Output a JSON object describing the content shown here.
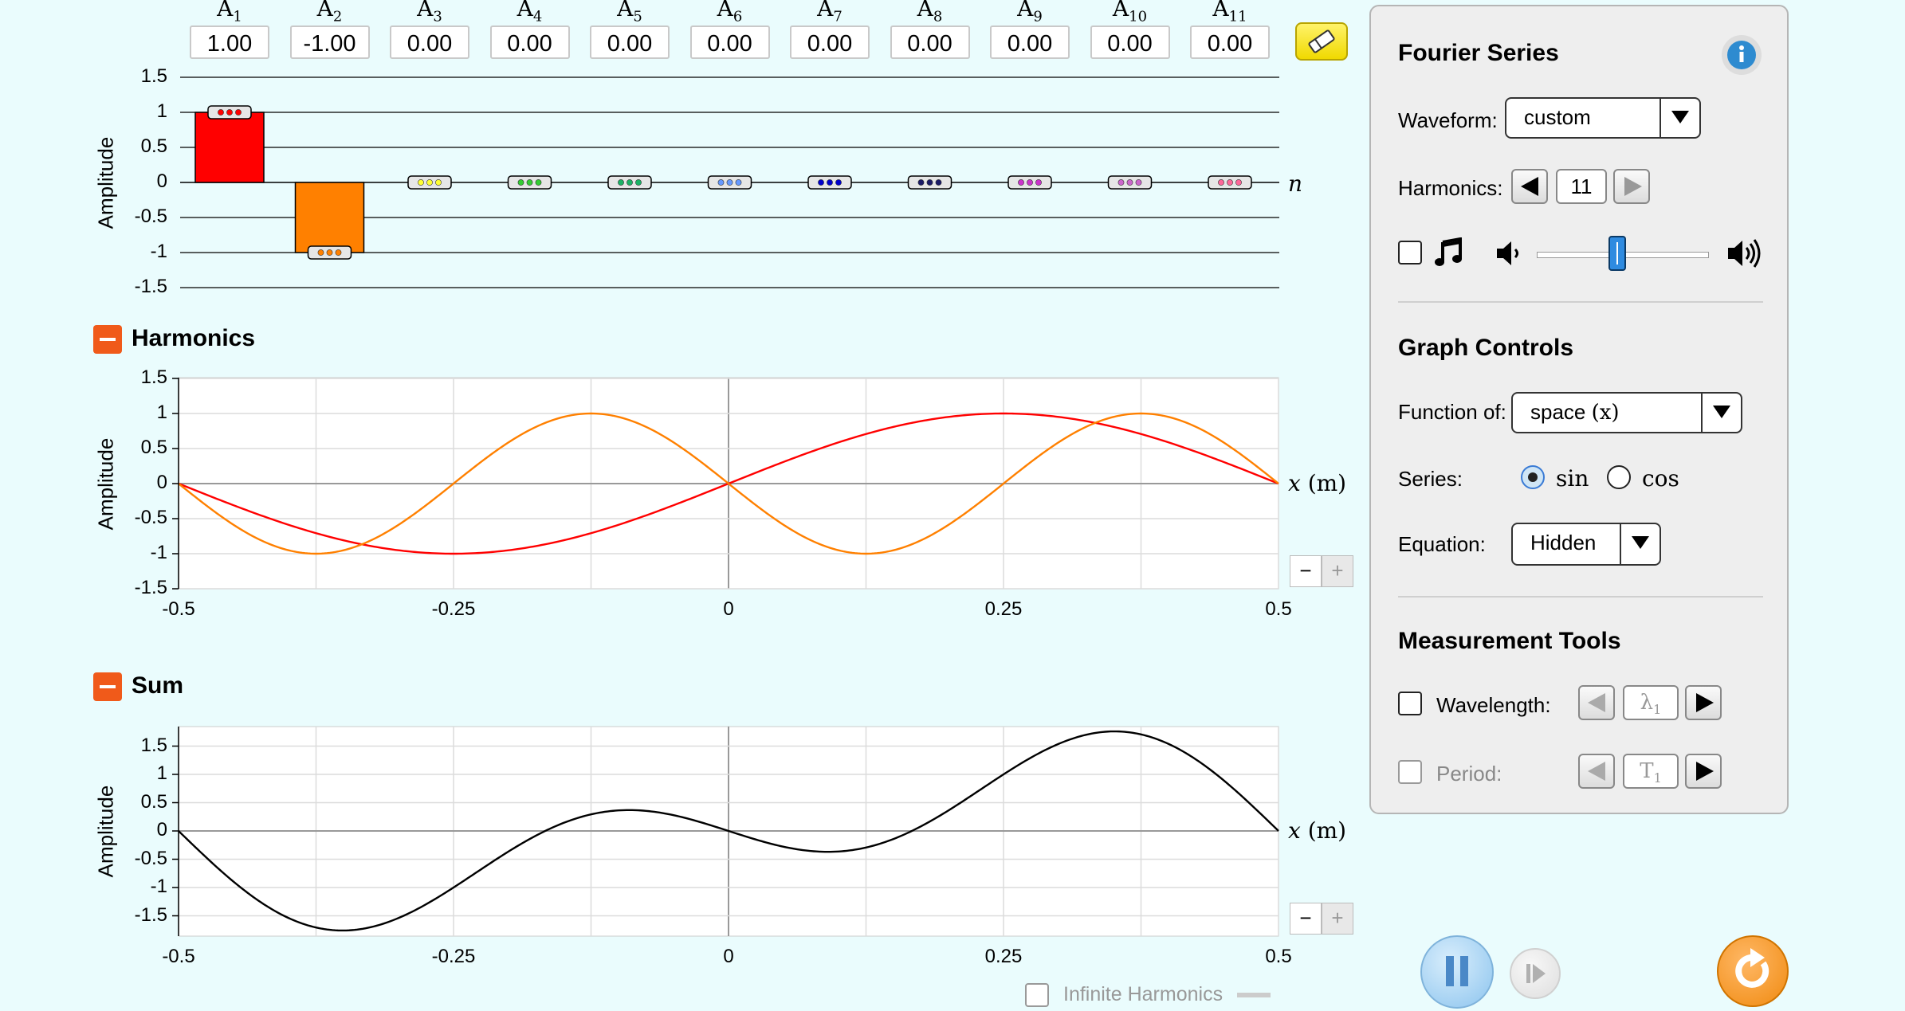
{
  "amplitudes": {
    "labels": [
      {
        "base": "A",
        "sub": "1"
      },
      {
        "base": "A",
        "sub": "2"
      },
      {
        "base": "A",
        "sub": "3"
      },
      {
        "base": "A",
        "sub": "4"
      },
      {
        "base": "A",
        "sub": "5"
      },
      {
        "base": "A",
        "sub": "6"
      },
      {
        "base": "A",
        "sub": "7"
      },
      {
        "base": "A",
        "sub": "8"
      },
      {
        "base": "A",
        "sub": "9"
      },
      {
        "base": "A",
        "sub": "10"
      },
      {
        "base": "A",
        "sub": "11"
      }
    ],
    "values": [
      "1.00",
      "-1.00",
      "0.00",
      "0.00",
      "0.00",
      "0.00",
      "0.00",
      "0.00",
      "0.00",
      "0.00",
      "0.00"
    ],
    "numeric": [
      1,
      -1,
      0,
      0,
      0,
      0,
      0,
      0,
      0,
      0,
      0
    ],
    "colors": [
      "#ff0000",
      "#ff8000",
      "#ffff33",
      "#33cc33",
      "#1ab265",
      "#6699ff",
      "#0000cc",
      "#1a1a66",
      "#cc33cc",
      "#cc66cc",
      "#ff6699"
    ],
    "y_ticks": [
      "1.5",
      "1",
      "0.5",
      "0",
      "-0.5",
      "-1",
      "-1.5"
    ],
    "y_title": "Amplitude",
    "x_var": "n"
  },
  "harmonics": {
    "header": "Harmonics",
    "y_title": "Amplitude",
    "y_ticks": [
      "1.5",
      "1",
      "0.5",
      "0",
      "-0.5",
      "-1",
      "-1.5"
    ],
    "x_ticks": [
      "-0.5",
      "-0.25",
      "0",
      "0.25",
      "0.5"
    ],
    "x_var": "x",
    "x_unit": "(m)",
    "zoom_minus": "−",
    "zoom_plus": "+"
  },
  "sum": {
    "header": "Sum",
    "y_title": "Amplitude",
    "y_ticks": [
      "1.5",
      "1",
      "0.5",
      "0",
      "-0.5",
      "-1",
      "-1.5"
    ],
    "x_ticks": [
      "-0.5",
      "-0.25",
      "0",
      "0.25",
      "0.5"
    ],
    "x_var": "x",
    "x_unit": "(m)",
    "zoom_minus": "−",
    "zoom_plus": "+",
    "infinite_label": "Infinite Harmonics"
  },
  "panel": {
    "title": "Fourier Series",
    "waveform_label": "Waveform:",
    "waveform_value": "custom",
    "harmonics_label": "Harmonics:",
    "harmonics_value": "11",
    "graph_controls_title": "Graph Controls",
    "function_label": "Function of:",
    "function_value": "space",
    "function_var": "(x)",
    "series_label": "Series:",
    "series_sin": "sin",
    "series_cos": "cos",
    "equation_label": "Equation:",
    "equation_value": "Hidden",
    "measurement_title": "Measurement Tools",
    "wavelength_label": "Wavelength:",
    "wavelength_symbol": "λ",
    "wavelength_sub": "1",
    "period_label": "Period:",
    "period_symbol": "T",
    "period_sub": "1",
    "volume_level": 0.47
  },
  "chart_data": [
    {
      "type": "bar",
      "categories": [
        "A1",
        "A2",
        "A3",
        "A4",
        "A5",
        "A6",
        "A7",
        "A8",
        "A9",
        "A10",
        "A11"
      ],
      "values": [
        1,
        -1,
        0,
        0,
        0,
        0,
        0,
        0,
        0,
        0,
        0
      ],
      "xlabel": "n",
      "ylabel": "Amplitude",
      "ylim": [
        -1.5,
        1.5
      ]
    },
    {
      "type": "line",
      "xlabel": "x (m)",
      "ylabel": "Amplitude",
      "xlim": [
        -0.5,
        0.5
      ],
      "ylim": [
        -1.5,
        1.5
      ],
      "grid": true,
      "series": [
        {
          "function": "sin(2*pi*x)",
          "color": "#ff0000",
          "x": [
            -0.5,
            -0.375,
            -0.25,
            -0.125,
            0,
            0.125,
            0.25,
            0.375,
            0.5
          ],
          "values": [
            0,
            -0.707,
            -1,
            -0.707,
            0,
            0.707,
            1,
            0.707,
            0
          ]
        },
        {
          "function": "-sin(4*pi*x)",
          "color": "#ff8000",
          "x": [
            -0.5,
            -0.375,
            -0.25,
            -0.125,
            0,
            0.125,
            0.25,
            0.375,
            0.5
          ],
          "values": [
            0,
            -1,
            0,
            1,
            0,
            -1,
            0,
            1,
            0
          ]
        }
      ]
    },
    {
      "type": "line",
      "xlabel": "x (m)",
      "ylabel": "Amplitude",
      "xlim": [
        -0.5,
        0.5
      ],
      "ylim": [
        -1.5,
        1.5
      ],
      "grid": true,
      "series": [
        {
          "function": "sin(2*pi*x) - sin(4*pi*x)",
          "color": "#000000",
          "x": [
            -0.5,
            -0.375,
            -0.25,
            -0.125,
            0,
            0.125,
            0.25,
            0.375,
            0.5
          ],
          "values": [
            0,
            -1.707,
            -1,
            0.293,
            0,
            -0.293,
            1,
            1.707,
            0
          ]
        }
      ]
    }
  ]
}
